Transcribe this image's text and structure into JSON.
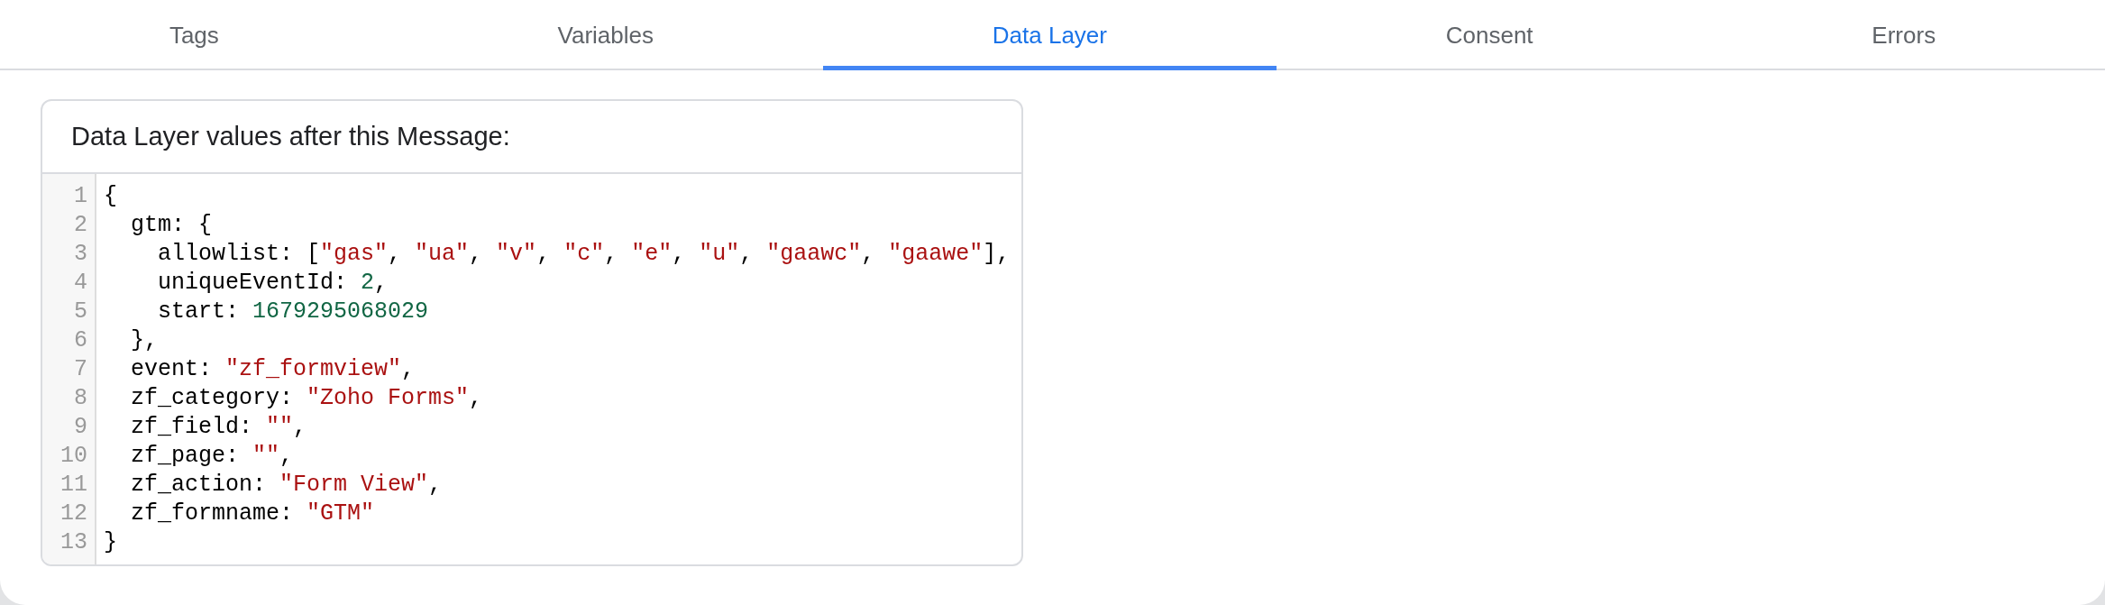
{
  "tabs": [
    {
      "label": "Tags",
      "selected": false
    },
    {
      "label": "Variables",
      "selected": false
    },
    {
      "label": "Data Layer",
      "selected": true
    },
    {
      "label": "Consent",
      "selected": false
    },
    {
      "label": "Errors",
      "selected": false
    }
  ],
  "data_layer_card": {
    "title": "Data Layer values after this Message:",
    "lines": [
      {
        "number": "1",
        "tokens": [
          {
            "kind": "plain",
            "text": "{"
          }
        ]
      },
      {
        "number": "2",
        "tokens": [
          {
            "kind": "plain",
            "text": "  gtm: {"
          }
        ]
      },
      {
        "number": "3",
        "tokens": [
          {
            "kind": "plain",
            "text": "    allowlist: ["
          },
          {
            "kind": "string",
            "text": "\"gas\""
          },
          {
            "kind": "plain",
            "text": ", "
          },
          {
            "kind": "string",
            "text": "\"ua\""
          },
          {
            "kind": "plain",
            "text": ", "
          },
          {
            "kind": "string",
            "text": "\"v\""
          },
          {
            "kind": "plain",
            "text": ", "
          },
          {
            "kind": "string",
            "text": "\"c\""
          },
          {
            "kind": "plain",
            "text": ", "
          },
          {
            "kind": "string",
            "text": "\"e\""
          },
          {
            "kind": "plain",
            "text": ", "
          },
          {
            "kind": "string",
            "text": "\"u\""
          },
          {
            "kind": "plain",
            "text": ", "
          },
          {
            "kind": "string",
            "text": "\"gaawc\""
          },
          {
            "kind": "plain",
            "text": ", "
          },
          {
            "kind": "string",
            "text": "\"gaawe\""
          },
          {
            "kind": "plain",
            "text": "],"
          }
        ]
      },
      {
        "number": "4",
        "tokens": [
          {
            "kind": "plain",
            "text": "    uniqueEventId: "
          },
          {
            "kind": "number",
            "text": "2"
          },
          {
            "kind": "plain",
            "text": ","
          }
        ]
      },
      {
        "number": "5",
        "tokens": [
          {
            "kind": "plain",
            "text": "    start: "
          },
          {
            "kind": "number",
            "text": "1679295068029"
          }
        ]
      },
      {
        "number": "6",
        "tokens": [
          {
            "kind": "plain",
            "text": "  },"
          }
        ]
      },
      {
        "number": "7",
        "tokens": [
          {
            "kind": "plain",
            "text": "  event: "
          },
          {
            "kind": "string",
            "text": "\"zf_formview\""
          },
          {
            "kind": "plain",
            "text": ","
          }
        ]
      },
      {
        "number": "8",
        "tokens": [
          {
            "kind": "plain",
            "text": "  zf_category: "
          },
          {
            "kind": "string",
            "text": "\"Zoho Forms\""
          },
          {
            "kind": "plain",
            "text": ","
          }
        ]
      },
      {
        "number": "9",
        "tokens": [
          {
            "kind": "plain",
            "text": "  zf_field: "
          },
          {
            "kind": "string",
            "text": "\"\""
          },
          {
            "kind": "plain",
            "text": ","
          }
        ]
      },
      {
        "number": "10",
        "tokens": [
          {
            "kind": "plain",
            "text": "  zf_page: "
          },
          {
            "kind": "string",
            "text": "\"\""
          },
          {
            "kind": "plain",
            "text": ","
          }
        ]
      },
      {
        "number": "11",
        "tokens": [
          {
            "kind": "plain",
            "text": "  zf_action: "
          },
          {
            "kind": "string",
            "text": "\"Form View\""
          },
          {
            "kind": "plain",
            "text": ","
          }
        ]
      },
      {
        "number": "12",
        "tokens": [
          {
            "kind": "plain",
            "text": "  zf_formname: "
          },
          {
            "kind": "string",
            "text": "\"GTM\""
          }
        ]
      },
      {
        "number": "13",
        "tokens": [
          {
            "kind": "plain",
            "text": "}"
          }
        ]
      }
    ]
  }
}
